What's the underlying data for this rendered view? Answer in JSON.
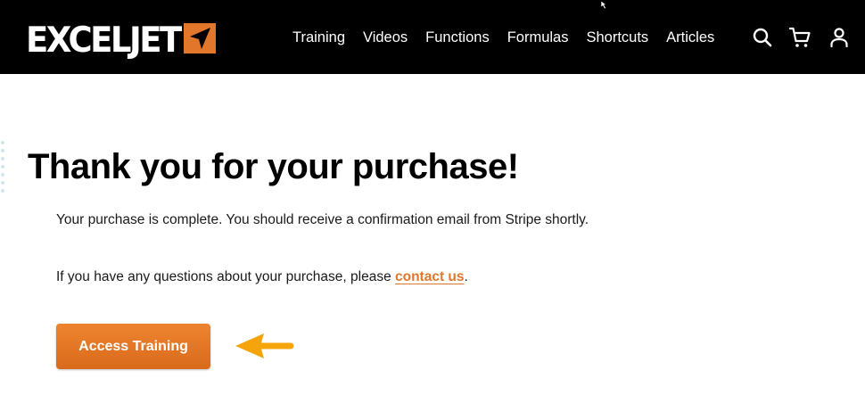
{
  "header": {
    "logo_text": "EXCELJET",
    "nav_items": [
      "Training",
      "Videos",
      "Functions",
      "Formulas",
      "Shortcuts",
      "Articles"
    ],
    "icons": [
      "search-icon",
      "cart-icon",
      "user-icon"
    ]
  },
  "main": {
    "title": "Thank you for your purchase!",
    "para1": "Your purchase is complete. You should receive a confirmation email from Stripe shortly.",
    "para2_prefix": "If you have any questions about your purchase, please ",
    "contact_link": "contact us",
    "para2_suffix": ".",
    "access_button": "Access Training"
  },
  "colors": {
    "header_bg": "#000000",
    "brand_orange": "#e2762a",
    "button_orange": "#e97a27",
    "arrow_yellow": "#f5a40c"
  }
}
